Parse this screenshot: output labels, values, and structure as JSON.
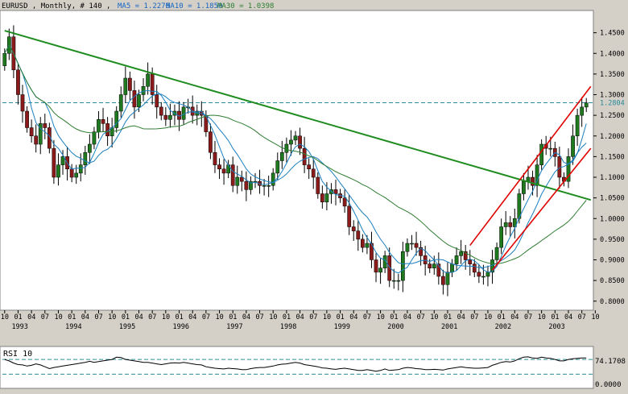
{
  "header": {
    "symbol_info": "EURUSD , Monthly, # 140 ,",
    "ma5": "MA5 = 1.2276",
    "ma10": "MA10 = 1.1850",
    "ma30": "MA30 = 1.0398"
  },
  "rsi_panel": {
    "label": "RSI 10",
    "value_label": "74.1708",
    "zero_label": "0.0000"
  },
  "colors": {
    "background": "#ffffff",
    "frame": "#d4d0c8",
    "up_candle": "#1f7a1f",
    "down_candle": "#8b1a1a",
    "wick": "#000000",
    "ma5": "#1a7fbf",
    "ma10": "#1a7fbf",
    "ma30": "#2e7d32",
    "trendline_green": "#1f8c1f",
    "channel_red": "#e00000",
    "dashed": "#2a8a9a",
    "ma5_text": "#1565c0",
    "ma30_text": "#2e7d32"
  },
  "chart_data": [
    {
      "type": "candlestick",
      "title": "",
      "x_tick_months": [
        "10",
        "01",
        "04",
        "07",
        "10",
        "01",
        "04",
        "07",
        "10",
        "01",
        "04",
        "07",
        "10",
        "01",
        "04",
        "07",
        "10",
        "01",
        "04",
        "07",
        "10",
        "01",
        "04",
        "07",
        "10",
        "01",
        "04",
        "07",
        "10",
        "01",
        "04",
        "07",
        "10",
        "01",
        "04",
        "07",
        "10",
        "01",
        "04",
        "07",
        "10",
        "01",
        "04",
        "07",
        "10"
      ],
      "x_years": [
        "1993",
        "1994",
        "1995",
        "1996",
        "1997",
        "1998",
        "1999",
        "2000",
        "2001",
        "2002",
        "2003"
      ],
      "y_ticks": [
        "1.4500",
        "1.4000",
        "1.3500",
        "1.3000",
        "1.2500",
        "1.2000",
        "1.1500",
        "1.1000",
        "1.0500",
        "1.0000",
        "0.9500",
        "0.9000",
        "0.8500",
        "0.8000"
      ],
      "ylim": [
        0.78,
        1.5
      ],
      "current_price": 1.2804,
      "current_price_label": "1.2804",
      "close_series": [
        1.4,
        1.44,
        1.36,
        1.3,
        1.26,
        1.22,
        1.2,
        1.18,
        1.23,
        1.22,
        1.17,
        1.1,
        1.13,
        1.15,
        1.12,
        1.1,
        1.11,
        1.13,
        1.16,
        1.18,
        1.21,
        1.24,
        1.23,
        1.2,
        1.22,
        1.26,
        1.3,
        1.34,
        1.31,
        1.27,
        1.3,
        1.32,
        1.35,
        1.3,
        1.27,
        1.25,
        1.24,
        1.25,
        1.26,
        1.24,
        1.27,
        1.27,
        1.25,
        1.26,
        1.25,
        1.21,
        1.16,
        1.13,
        1.12,
        1.11,
        1.13,
        1.08,
        1.1,
        1.09,
        1.07,
        1.09,
        1.09,
        1.08,
        1.08,
        1.08,
        1.11,
        1.14,
        1.16,
        1.18,
        1.19,
        1.2,
        1.17,
        1.13,
        1.12,
        1.1,
        1.06,
        1.04,
        1.06,
        1.07,
        1.06,
        1.05,
        1.03,
        0.98,
        0.97,
        0.95,
        0.93,
        0.94,
        0.9,
        0.87,
        0.88,
        0.91,
        0.85,
        0.85,
        0.85,
        0.92,
        0.94,
        0.94,
        0.93,
        0.91,
        0.89,
        0.88,
        0.89,
        0.86,
        0.84,
        0.87,
        0.89,
        0.91,
        0.92,
        0.9,
        0.89,
        0.87,
        0.86,
        0.86,
        0.87,
        0.9,
        0.93,
        0.98,
        0.99,
        0.98,
        1.0,
        1.06,
        1.09,
        1.1,
        1.08,
        1.13,
        1.18,
        1.17,
        1.17,
        1.15,
        1.1,
        1.09,
        1.15,
        1.2,
        1.25,
        1.27,
        1.28
      ],
      "series": [
        {
          "name": "MA5",
          "value": 1.2276
        },
        {
          "name": "MA10",
          "value": 1.185
        },
        {
          "name": "MA30",
          "value": 1.0398
        }
      ],
      "trendline_points": [
        [
          0,
          1.455
        ],
        [
          131,
          1.045
        ]
      ],
      "channel_upper": [
        [
          104,
          0.935
        ],
        [
          131,
          1.32
        ]
      ],
      "channel_lower": [
        [
          109,
          0.875
        ],
        [
          131,
          1.17
        ]
      ]
    },
    {
      "type": "line",
      "title": "",
      "series": [
        {
          "name": "RSI 10",
          "value": 74.1708
        }
      ],
      "rsi_series": [
        70,
        66,
        60,
        56,
        55,
        52,
        54,
        58,
        55,
        50,
        45,
        48,
        50,
        52,
        54,
        56,
        58,
        60,
        62,
        65,
        62,
        64,
        66,
        68,
        70,
        76,
        75,
        70,
        68,
        66,
        64,
        62,
        62,
        60,
        58,
        56,
        58,
        60,
        61,
        60,
        62,
        60,
        58,
        56,
        55,
        50,
        48,
        46,
        45,
        44,
        46,
        45,
        44,
        42,
        42,
        45,
        47,
        48,
        48,
        50,
        52,
        55,
        57,
        58,
        60,
        62,
        60,
        56,
        54,
        52,
        50,
        47,
        46,
        44,
        43,
        45,
        46,
        44,
        42,
        40,
        40,
        42,
        40,
        38,
        40,
        44,
        40,
        41,
        42,
        46,
        48,
        47,
        45,
        44,
        42,
        42,
        43,
        42,
        41,
        44,
        46,
        48,
        50,
        48,
        47,
        46,
        46,
        47,
        48,
        54,
        58,
        62,
        64,
        63,
        66,
        72,
        76,
        77,
        74,
        73,
        76,
        74,
        73,
        70,
        66,
        66,
        70,
        72,
        73,
        74,
        74
      ],
      "levels": [
        70,
        30
      ]
    }
  ]
}
